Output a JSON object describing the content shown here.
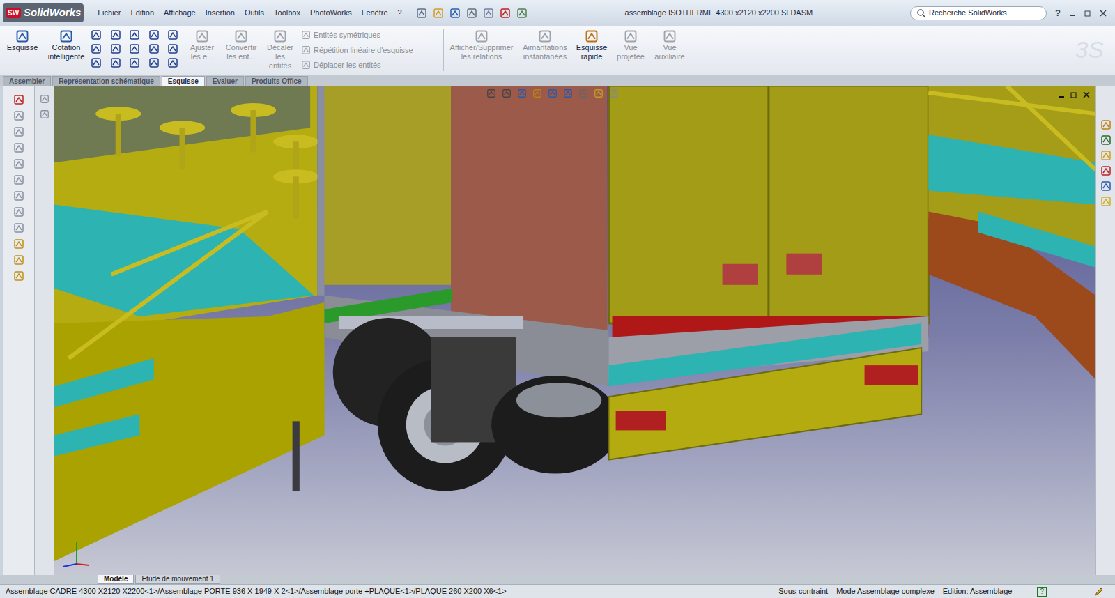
{
  "window": {
    "title": "assemblage ISOTHERME 4300 x2120 x2200.SLDASM",
    "logo": "SolidWorks",
    "logo_badge": "SW"
  },
  "menu": [
    "Fichier",
    "Edition",
    "Affichage",
    "Insertion",
    "Outils",
    "Toolbox",
    "PhotoWorks",
    "Fenêtre",
    "?"
  ],
  "search": {
    "placeholder": "Recherche SolidWorks"
  },
  "help": "?",
  "command_manager": {
    "big_left": [
      {
        "lines": [
          "Esquisse"
        ],
        "disabled": false
      },
      {
        "lines": [
          "Cotation",
          "intelligente"
        ],
        "disabled": false
      }
    ],
    "mid": [
      {
        "lines": [
          "Ajuster",
          "les e..."
        ],
        "disabled": true
      },
      {
        "lines": [
          "Convertir",
          "les ent..."
        ],
        "disabled": true
      },
      {
        "lines": [
          "Décaler",
          "les",
          "entités"
        ],
        "disabled": true
      }
    ],
    "small": [
      {
        "label": "Entités symétriques",
        "disabled": true
      },
      {
        "label": "Répétition linéaire d'esquisse",
        "disabled": true
      },
      {
        "label": "Déplacer les entités",
        "disabled": true
      }
    ],
    "big_right": [
      {
        "lines": [
          "Afficher/Supprimer",
          "les relations"
        ],
        "disabled": true
      },
      {
        "lines": [
          "Aimantations",
          "instantanées"
        ],
        "disabled": true
      },
      {
        "lines": [
          "Esquisse",
          "rapide"
        ],
        "disabled": false
      },
      {
        "lines": [
          "Vue",
          "projetée"
        ],
        "disabled": true
      },
      {
        "lines": [
          "Vue",
          "auxiliaire"
        ],
        "disabled": true
      }
    ]
  },
  "tabs": [
    {
      "label": "Assembler",
      "selected": false
    },
    {
      "label": "Représentation schématique",
      "selected": false
    },
    {
      "label": "Esquisse",
      "selected": true
    },
    {
      "label": "Evaluer",
      "selected": false
    },
    {
      "label": "Produits Office",
      "selected": false
    }
  ],
  "bottom_tabs": [
    {
      "label": "Modèle",
      "selected": true
    },
    {
      "label": "Etude de mouvement 1",
      "selected": false
    }
  ],
  "status_bar": {
    "path": "Assemblage  CADRE 4300 X2120 X2200<1>/Assemblage PORTE  936 X 1949 X 2<1>/Assemblage porte +PLAQUE<1>/PLAQUE 260 X200 X6<1>",
    "items": [
      "Sous-contraint",
      "Mode Assemblage complexe",
      "Edition: Assemblage"
    ],
    "help": "?"
  }
}
